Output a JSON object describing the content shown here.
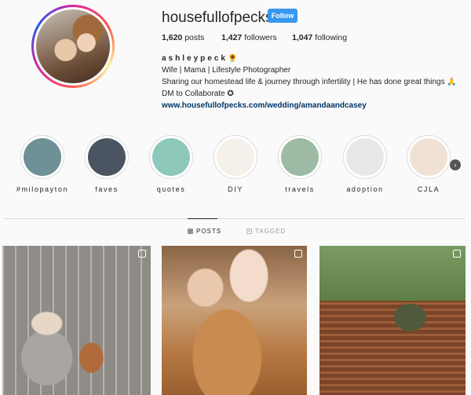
{
  "profile": {
    "username": "housefullofpecks",
    "follow_label": "Follow",
    "stats": {
      "posts_count": "1,620",
      "posts_label": " posts",
      "followers_count": "1,427",
      "followers_label": " followers",
      "following_count": "1,047",
      "following_label": " following"
    },
    "bio": {
      "name": "ashleypeck",
      "name_emoji": "🌻",
      "line1": "Wife | Mama | Lifestyle Photographer",
      "line2": "Sharing our homestead life & journey through infertility | He has done great things 🙏",
      "line3": "DM to Collaborate ✪",
      "link": "www.housefullofpecks.com/wedding/amandaandcasey"
    }
  },
  "highlights": [
    {
      "label": "#milopayton",
      "color": "#6e9096"
    },
    {
      "label": "faves",
      "color": "#4b5562"
    },
    {
      "label": "quotes",
      "color": "#8dc8bb"
    },
    {
      "label": "DIY",
      "color": "#f6f0ea"
    },
    {
      "label": "travels",
      "color": "#9dbba4"
    },
    {
      "label": "adoption",
      "color": "#e8e8e8"
    },
    {
      "label": "CJLA",
      "color": "#efe2d4"
    }
  ],
  "tabs": {
    "posts_label": "POSTS",
    "tagged_label": "TAGGED"
  },
  "icons": {
    "posts_tab": "grid-icon",
    "tagged_tab": "tag-icon",
    "next": "chevron-right-icon",
    "multi_post": "multiple-images-icon"
  },
  "colors": {
    "follow_button": "#3897f0",
    "link": "#003569"
  }
}
